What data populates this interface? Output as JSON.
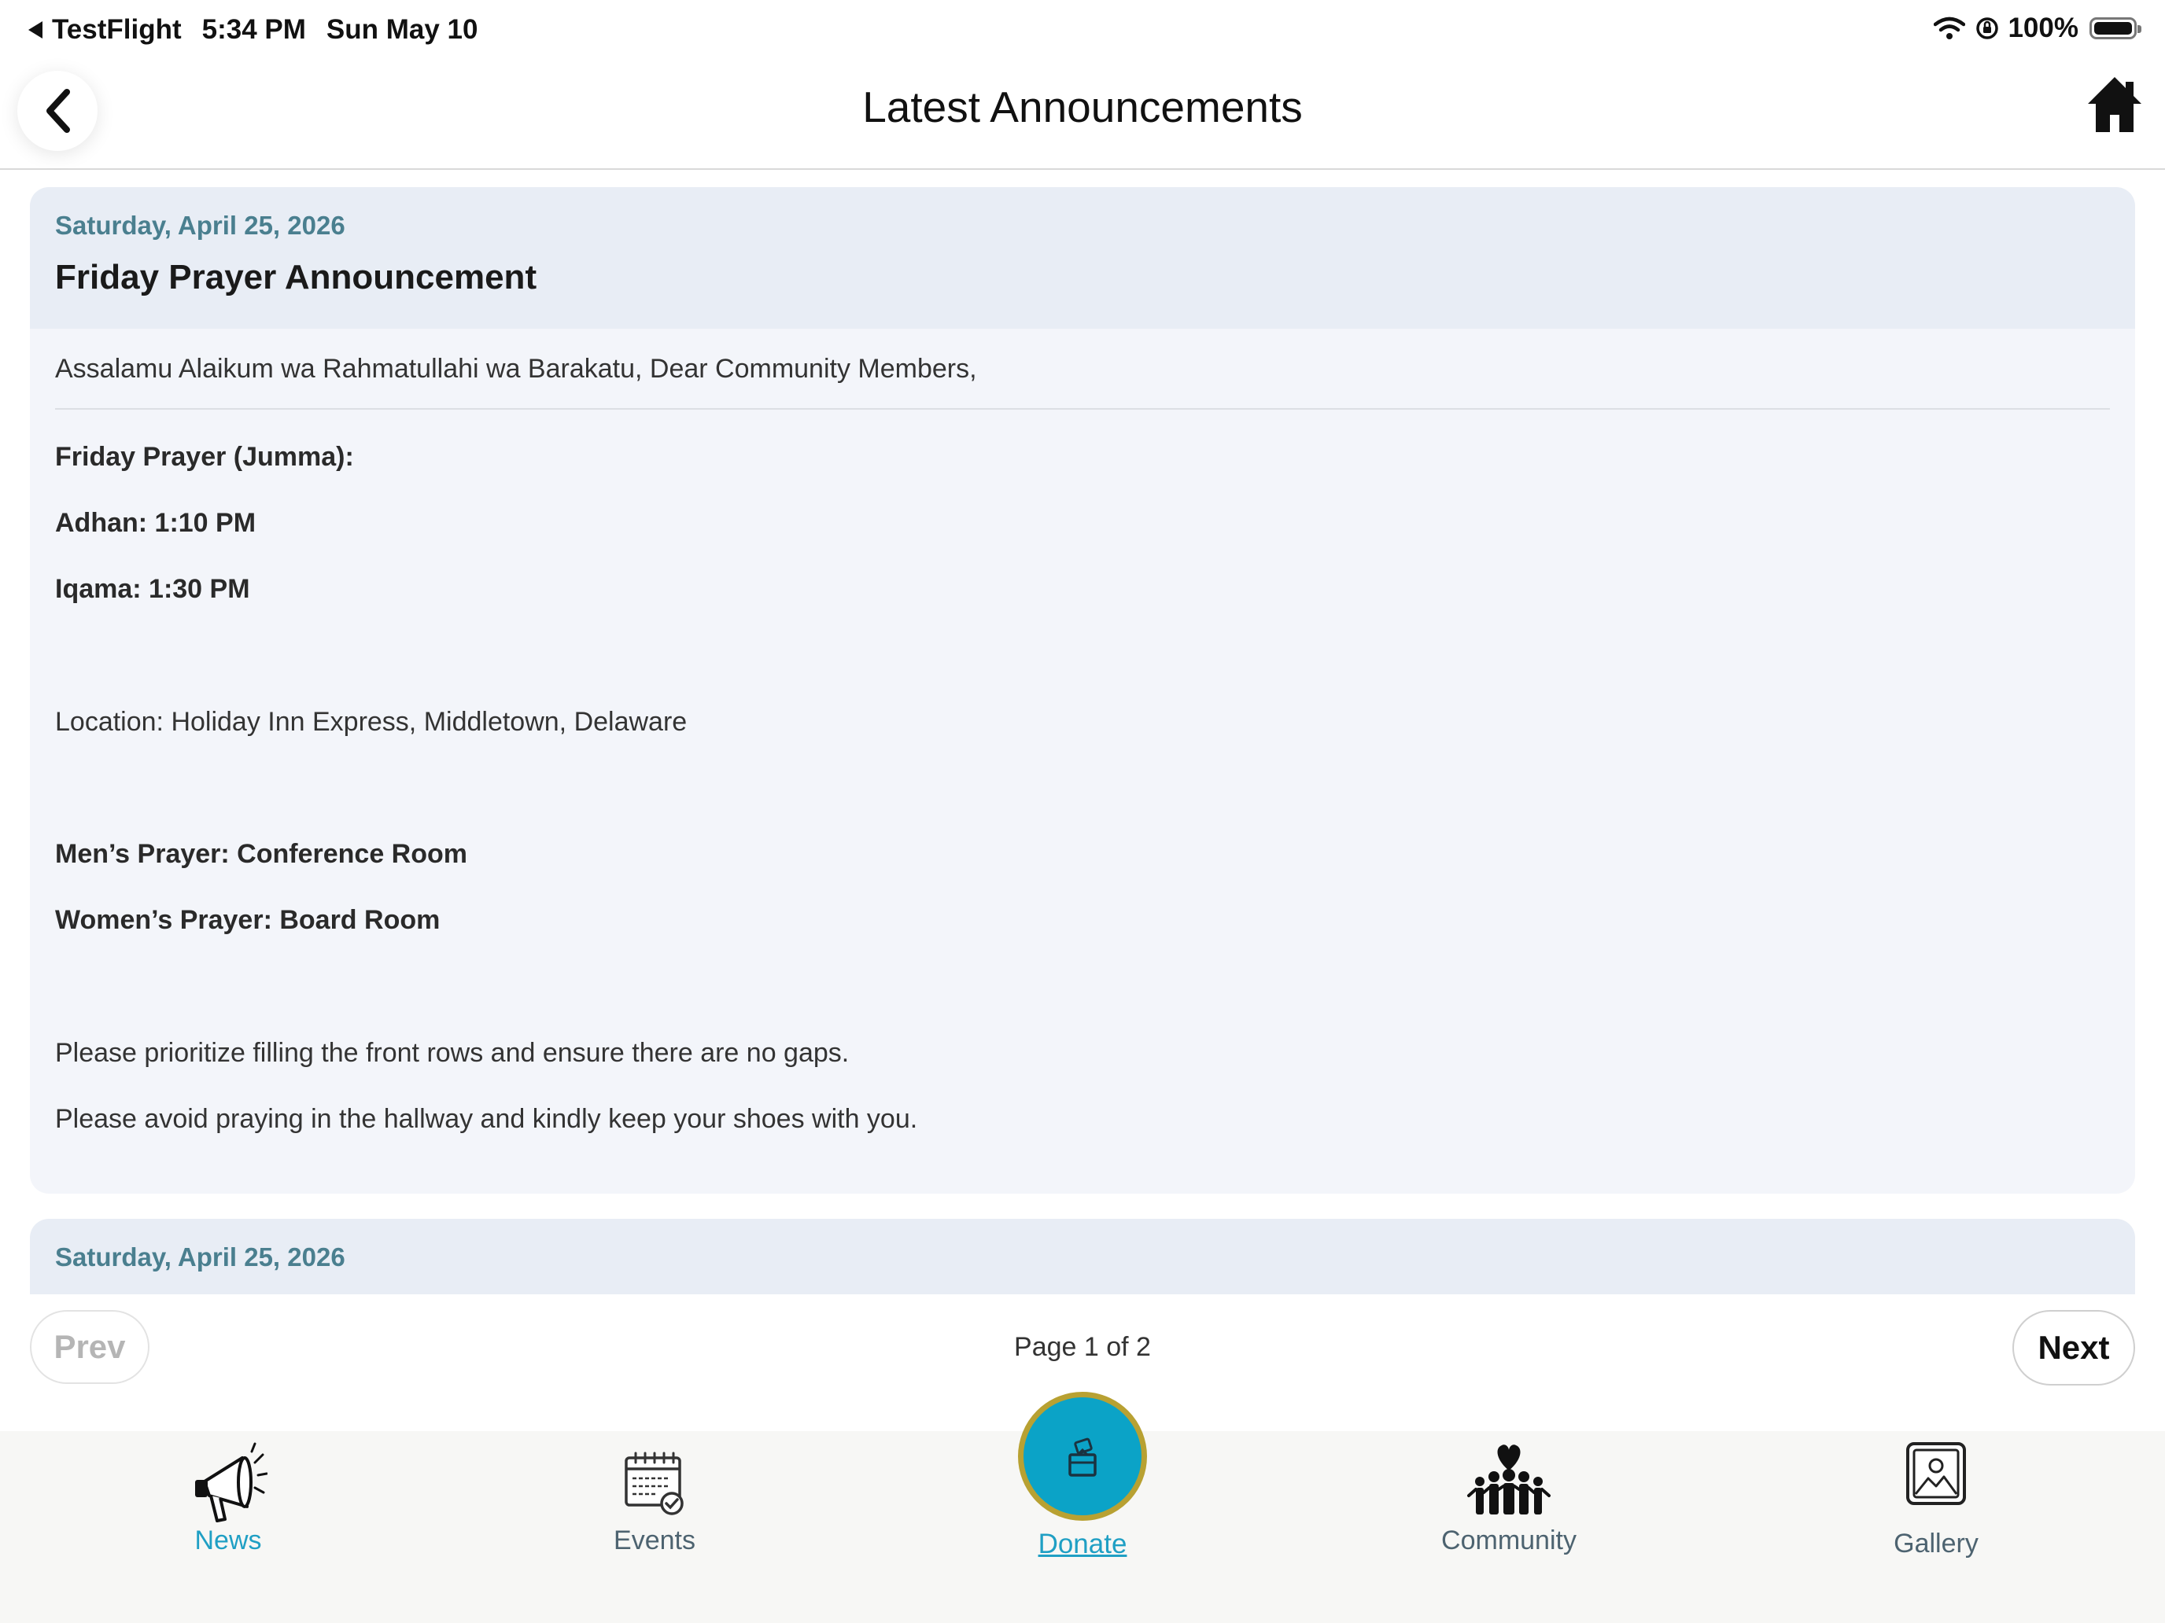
{
  "status_bar": {
    "back_app": "TestFlight",
    "time": "5:34 PM",
    "date": "Sun May 10",
    "battery": "100%"
  },
  "header": {
    "title": "Latest Announcements"
  },
  "announcements": [
    {
      "date": "Saturday, April 25, 2026",
      "title": "Friday Prayer Announcement",
      "greeting": "Assalamu Alaikum wa Rahmatullahi wa Barakatu, Dear Community Members,",
      "lines": [
        {
          "text": "Friday Prayer (Jumma):",
          "bold": true
        },
        {
          "text": "Adhan: 1:10 PM",
          "bold": true
        },
        {
          "text": "Iqama: 1:30 PM",
          "bold": true
        },
        {
          "text": "Location: Holiday Inn Express, Middletown, Delaware",
          "bold": false
        },
        {
          "text": "Men’s Prayer: Conference Room",
          "bold": true
        },
        {
          "text": "Women’s Prayer: Board Room",
          "bold": true
        },
        {
          "text": "Please prioritize filling the front rows and ensure there are no gaps.",
          "bold": false
        },
        {
          "text": "Please avoid praying in the hallway and kindly keep your shoes with you.",
          "bold": false
        }
      ]
    },
    {
      "date": "Saturday, April 25, 2026"
    }
  ],
  "pagination": {
    "prev_label": "Prev",
    "next_label": "Next",
    "indicator": "Page 1 of 2"
  },
  "tabs": {
    "news": "News",
    "events": "Events",
    "donate": "Donate",
    "community": "Community",
    "gallery": "Gallery",
    "active": "news",
    "accent_color": "#1f9fc4",
    "donate_color": "#0ba3c7"
  }
}
